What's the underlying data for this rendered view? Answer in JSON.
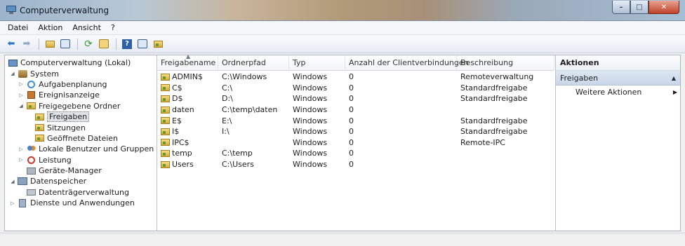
{
  "window": {
    "title": "Computerverwaltung"
  },
  "menubar": {
    "items": [
      "Datei",
      "Aktion",
      "Ansicht",
      "?"
    ]
  },
  "toolbar": {
    "buttons": [
      "back-arrow-icon",
      "forward-arrow-icon",
      "up-folder-icon",
      "show-hide-tree-icon",
      "refresh-icon",
      "export-list-icon",
      "help-icon",
      "show-hide-action-pane-icon",
      "new-share-icon"
    ]
  },
  "tree": {
    "items": [
      {
        "label": "Computerverwaltung (Lokal)",
        "icon": "computer-management-icon"
      },
      {
        "label": "System",
        "icon": "tools-icon"
      },
      {
        "label": "Aufgabenplanung",
        "icon": "clock-icon"
      },
      {
        "label": "Ereignisanzeige",
        "icon": "event-viewer-icon"
      },
      {
        "label": "Freigegebene Ordner",
        "icon": "shared-folder-icon"
      },
      {
        "label": "Freigaben",
        "icon": "share-icon"
      },
      {
        "label": "Sitzungen",
        "icon": "share-icon"
      },
      {
        "label": "Geöffnete Dateien",
        "icon": "share-icon"
      },
      {
        "label": "Lokale Benutzer und Gruppen",
        "icon": "users-icon"
      },
      {
        "label": "Leistung",
        "icon": "performance-icon"
      },
      {
        "label": "Geräte-Manager",
        "icon": "device-manager-icon"
      },
      {
        "label": "Datenspeicher",
        "icon": "storage-icon"
      },
      {
        "label": "Datenträgerverwaltung",
        "icon": "disk-icon"
      },
      {
        "label": "Dienste und Anwendungen",
        "icon": "services-icon"
      }
    ]
  },
  "list": {
    "columns": [
      "Freigabename",
      "Ordnerpfad",
      "Typ",
      "Anzahl der Clientverbindungen",
      "Beschreibung"
    ],
    "rows": [
      {
        "name": "ADMIN$",
        "path": "C:\\Windows",
        "type": "Windows",
        "connections": "0",
        "description": "Remoteverwaltung"
      },
      {
        "name": "C$",
        "path": "C:\\",
        "type": "Windows",
        "connections": "0",
        "description": "Standardfreigabe"
      },
      {
        "name": "D$",
        "path": "D:\\",
        "type": "Windows",
        "connections": "0",
        "description": "Standardfreigabe"
      },
      {
        "name": "daten",
        "path": "C:\\temp\\daten",
        "type": "Windows",
        "connections": "0",
        "description": ""
      },
      {
        "name": "E$",
        "path": "E:\\",
        "type": "Windows",
        "connections": "0",
        "description": "Standardfreigabe"
      },
      {
        "name": "I$",
        "path": "I:\\",
        "type": "Windows",
        "connections": "0",
        "description": "Standardfreigabe"
      },
      {
        "name": "IPC$",
        "path": "",
        "type": "Windows",
        "connections": "0",
        "description": "Remote-IPC"
      },
      {
        "name": "temp",
        "path": "C:\\temp",
        "type": "Windows",
        "connections": "0",
        "description": ""
      },
      {
        "name": "Users",
        "path": "C:\\Users",
        "type": "Windows",
        "connections": "0",
        "description": ""
      }
    ]
  },
  "actions": {
    "header": "Aktionen",
    "section": "Freigaben",
    "item": "Weitere Aktionen"
  },
  "colors": {
    "accent": "#2e7cc7",
    "selection": "#dfe3e8"
  }
}
